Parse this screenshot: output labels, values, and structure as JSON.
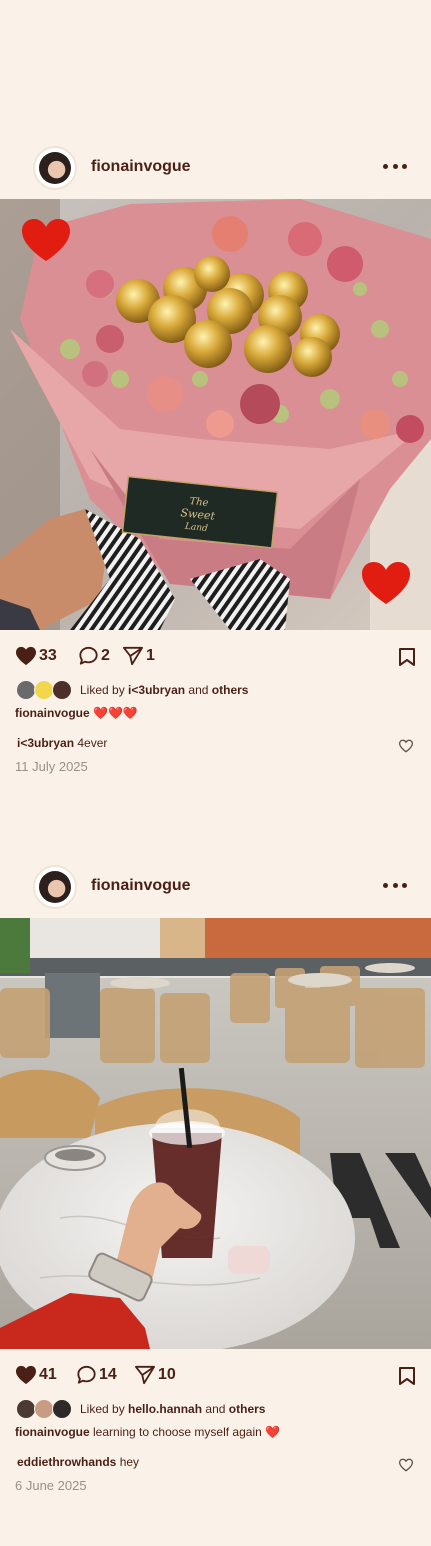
{
  "posts": [
    {
      "username": "fionainvogue",
      "likes": "33",
      "comments": "2",
      "shares": "1",
      "liked_by_prefix": "Liked by",
      "liked_by_user": "i<3ubryan",
      "liked_by_and": "and",
      "liked_by_others": "others",
      "caption_user": "fionainvogue",
      "caption_text": "❤️❤️❤️",
      "comment_user": "i<3ubryan",
      "comment_text": "4ever",
      "date": "11 July 2025",
      "photo_label_1": "The",
      "photo_label_2": "Sweet",
      "photo_label_3": "Land"
    },
    {
      "username": "fionainvogue",
      "likes": "41",
      "comments": "14",
      "shares": "10",
      "liked_by_prefix": "Liked by",
      "liked_by_user": "hello.hannah",
      "liked_by_and": "and",
      "liked_by_others": "others",
      "caption_user": "fionainvogue",
      "caption_text": "learning to choose myself again ❤️",
      "comment_user": "eddiethrowhands",
      "comment_text": "hey",
      "date": "6 June 2025"
    }
  ],
  "colors": {
    "background": "#faf2e8",
    "text": "#4a1f16",
    "muted": "#9a8f88",
    "heart_red": "#e11d12"
  },
  "icons": [
    "heart-icon",
    "comment-icon",
    "share-icon",
    "bookmark-icon",
    "more-icon"
  ]
}
